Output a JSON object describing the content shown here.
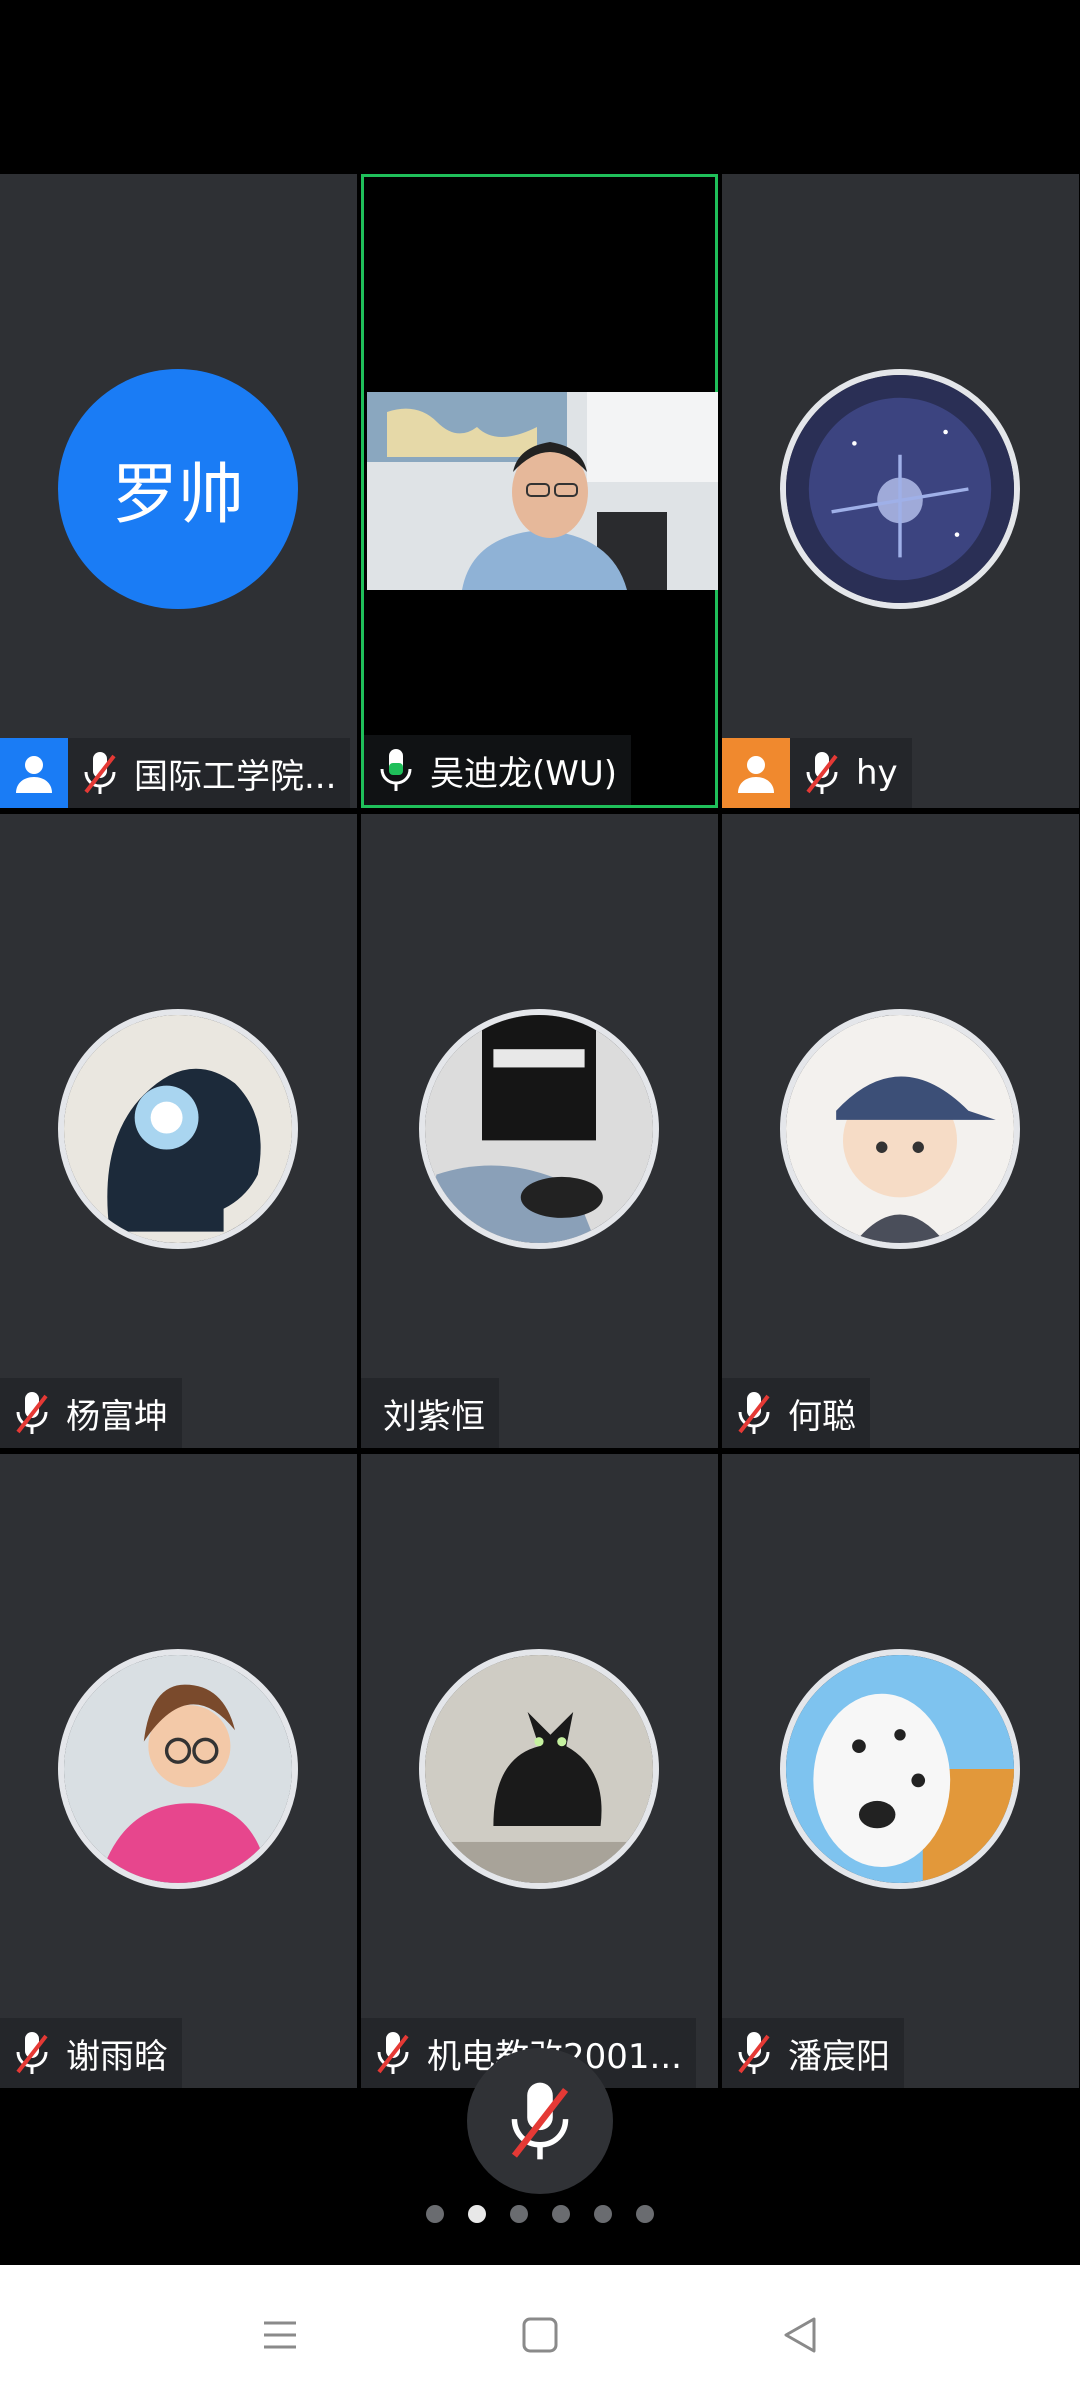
{
  "participants": [
    {
      "name": "国际工学院...",
      "avatar_text": "罗帅",
      "role_color": "#1a7cf5",
      "mic": "muted"
    },
    {
      "name": "吴迪龙(WU)",
      "mic": "active",
      "video": true
    },
    {
      "name": "hy",
      "role_color": "#f0892e",
      "mic": "muted",
      "avatar_icon": "galaxy-avatar-icon"
    },
    {
      "name": "杨富坤",
      "mic": "muted",
      "avatar_icon": "silhouette-avatar-icon"
    },
    {
      "name": "刘紫恒",
      "mic": "none",
      "avatar_icon": "lakers-jersey-avatar-icon"
    },
    {
      "name": "何聪",
      "mic": "muted",
      "avatar_icon": "cartoon-boy-avatar-icon"
    },
    {
      "name": "谢雨晗",
      "mic": "muted",
      "avatar_icon": "cartoon-girl-avatar-icon"
    },
    {
      "name": "机电教改2001...",
      "mic": "muted",
      "avatar_icon": "black-cat-avatar-icon"
    },
    {
      "name": "潘宸阳",
      "mic": "muted",
      "avatar_icon": "dalmatian-avatar-icon"
    }
  ],
  "page_indicator": {
    "total": 6,
    "current": 2
  },
  "colors": {
    "tile_bg": "#2e3034",
    "active_speaker_border": "#1fbf5a",
    "mute_slash": "#e53935",
    "brand_blue": "#1a7cf5"
  }
}
